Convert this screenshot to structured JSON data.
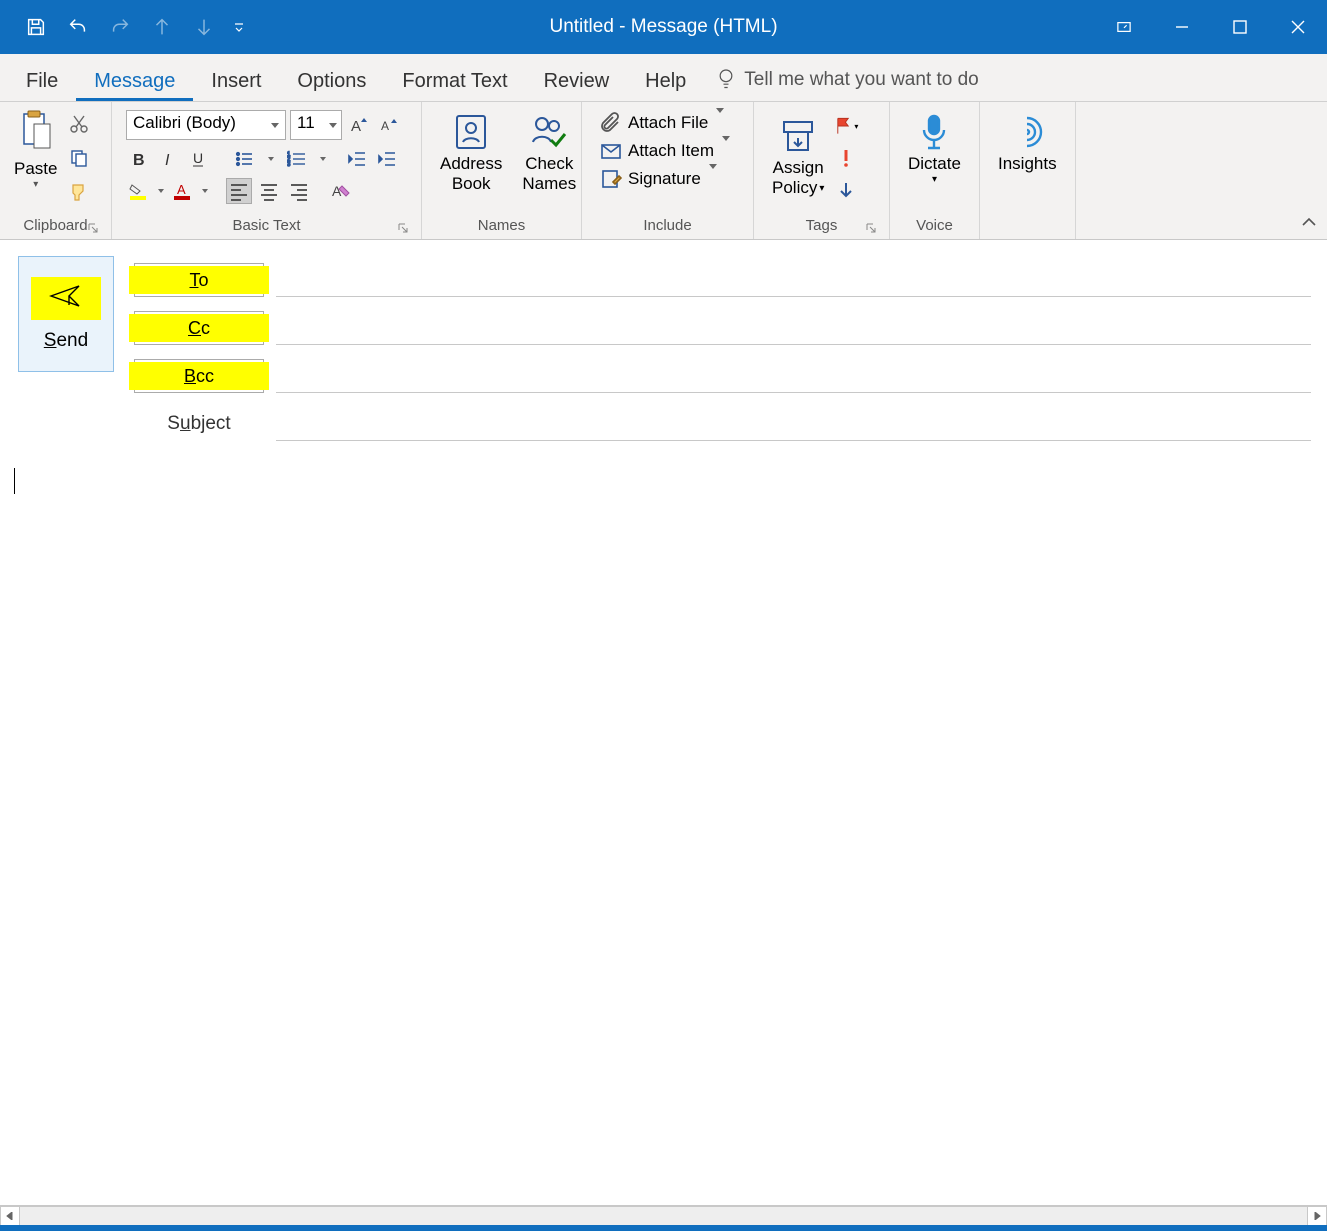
{
  "titlebar": {
    "title": "Untitled  -  Message (HTML)"
  },
  "tabs": {
    "file": "File",
    "message": "Message",
    "insert": "Insert",
    "options": "Options",
    "formatText": "Format Text",
    "review": "Review",
    "help": "Help",
    "tellMe": "Tell me what you want to do"
  },
  "ribbon": {
    "clipboard": {
      "label": "Clipboard",
      "paste": "Paste"
    },
    "basicText": {
      "label": "Basic Text",
      "font": "Calibri (Body)",
      "size": "11"
    },
    "names": {
      "label": "Names",
      "addressBook1": "Address",
      "addressBook2": "Book",
      "checkNames1": "Check",
      "checkNames2": "Names"
    },
    "include": {
      "label": "Include",
      "attachFile": "Attach File",
      "attachItem": "Attach Item",
      "signature": "Signature"
    },
    "tags": {
      "label": "Tags",
      "assignPolicy1": "Assign",
      "assignPolicy2": "Policy"
    },
    "voice": {
      "label": "Voice",
      "dictate": "Dictate"
    },
    "insights": {
      "label": "Insights"
    }
  },
  "compose": {
    "send": "Send",
    "to": "To",
    "cc": "Cc",
    "bcc": "Bcc",
    "subject": "Subject"
  }
}
